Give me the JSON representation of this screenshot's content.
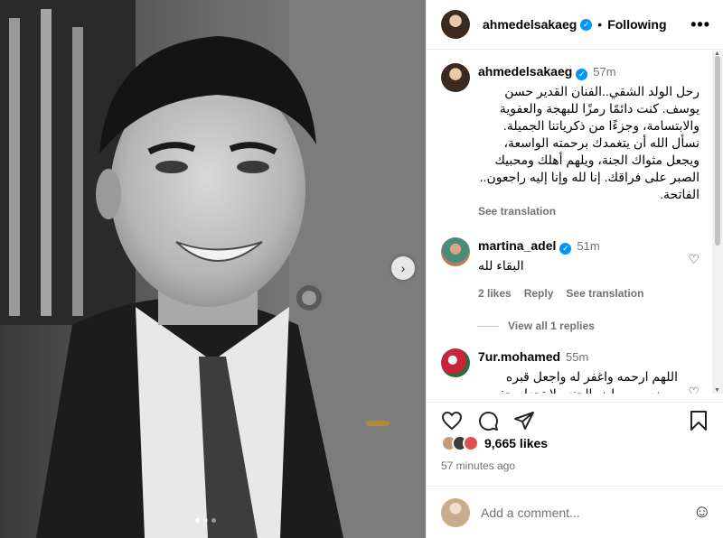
{
  "post": {
    "author": "ahmedelsakaeg",
    "verified_icon": "verified-badge-icon",
    "follow_separator": "•",
    "follow_status": "Following",
    "more_label": "•••",
    "carousel_next": "›"
  },
  "caption": {
    "author": "ahmedelsakaeg",
    "time": "57m",
    "text": "رحل الولد الشقي..الفنان القدير حسن يوسف. كنت دائمًا رمزًا للبهجة والعفوية والابتسامة، وجزءًا من ذكرياتنا الجميلة. نسأل الله أن يتغمدك برحمته الواسعة، ويجعل مثواك الجنة، ويلهم أهلك ومحبيك الصبر على فراقك. إنا لله وإنا إليه راجعون.. الفاتحة.",
    "see_translation": "See translation"
  },
  "comments": [
    {
      "author": "martina_adel",
      "time": "51m",
      "text": "البقاء لله",
      "likes": "2 likes",
      "reply": "Reply",
      "see_translation": "See translation",
      "view_replies": "View all 1 replies"
    },
    {
      "author": "7ur.mohamed",
      "time": "55m",
      "text": "اللهم ارحمه واغفر له واجعل قبره روضه من رياض الجنه ولا تجعله حفره من حفر النار اللهم احشره بالفردوس الاعلى"
    }
  ],
  "likes": {
    "count": "9,665 likes"
  },
  "posted_ago": "57 minutes ago",
  "composer": {
    "placeholder": "Add a comment...",
    "emoji": "☺"
  },
  "colors": {
    "accent": "#0095f6",
    "muted": "#737373",
    "border": "#efefef"
  }
}
